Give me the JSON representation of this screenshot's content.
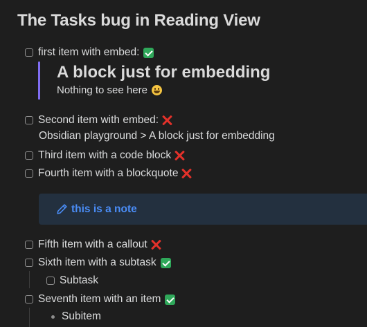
{
  "page": {
    "title": "The Tasks bug in Reading View"
  },
  "tasks": [
    {
      "text": "first item with embed:",
      "status": "check"
    },
    {
      "text": "Second item with embed:",
      "status": "cross"
    },
    {
      "text": "Third item with a code block",
      "status": "cross"
    },
    {
      "text": "Fourth item with a blockquote",
      "status": "cross"
    },
    {
      "text": "Fifth item with a callout",
      "status": "cross"
    },
    {
      "text": "Sixth item with a subtask",
      "status": "check"
    },
    {
      "text": "Seventh item with an item",
      "status": "check"
    }
  ],
  "embed": {
    "heading": "A block just for embedding",
    "text": "Nothing to see here",
    "emoji_icon": "grinning-face-icon",
    "accent_color": "#7f6df2"
  },
  "embed_link": {
    "text": "Obsidian playground > A block just for embedding"
  },
  "callout": {
    "title": "this is a note",
    "icon": "pencil-icon",
    "color": "#4a8df7",
    "background": "#23303f"
  },
  "subtask": {
    "text": "Subtask"
  },
  "subitem": {
    "text": "Subitem"
  },
  "colors": {
    "background": "#1e1e1e",
    "text": "#dcddde",
    "check": "#2fa85a",
    "cross": "#e3312a"
  }
}
